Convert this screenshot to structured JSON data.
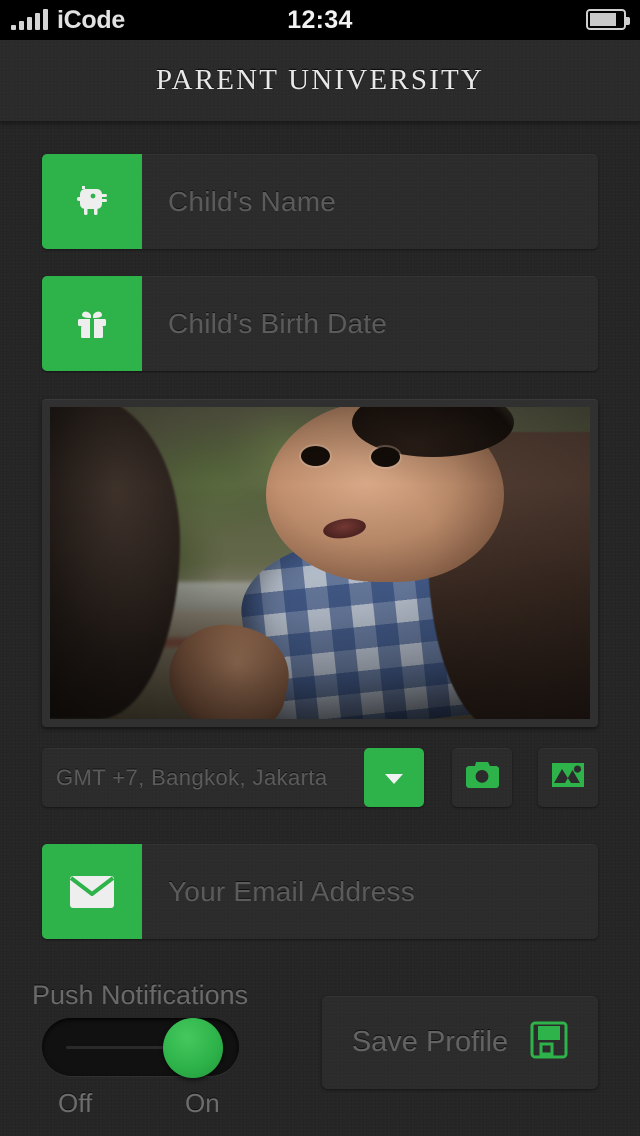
{
  "status_bar": {
    "carrier": "iCode",
    "time": "12:34",
    "signal_icon": "signal-bars-icon",
    "battery_icon": "battery-icon",
    "battery_level_percent": 72
  },
  "header": {
    "title": "PARENT UNIVERSITY"
  },
  "form": {
    "fields": [
      {
        "name": "child-name",
        "placeholder": "Child's Name",
        "value": "",
        "icon": "baby-animal-icon"
      },
      {
        "name": "child-birth-date",
        "placeholder": "Child's Birth Date",
        "value": "",
        "icon": "gift-icon"
      },
      {
        "name": "email-address",
        "placeholder": "Your Email Address",
        "value": "",
        "icon": "envelope-icon"
      }
    ],
    "photo": {
      "alt": "child photo preview",
      "icon": "photo-preview"
    },
    "timezone": {
      "value": "GMT +7, Bangkok, Jakarta",
      "dropdown_icon": "chevron-down-icon"
    },
    "camera_button": {
      "icon": "camera-icon"
    },
    "gallery_button": {
      "icon": "image-icon"
    },
    "push_notifications": {
      "label": "Push Notifications",
      "state": "On",
      "off_label": "Off",
      "on_label": "On"
    },
    "save": {
      "label": "Save Profile",
      "icon": "floppy-disk-save-icon"
    }
  },
  "colors": {
    "accent_green": "#2eb34a",
    "background": "#262626",
    "field_background": "#2c2c2c",
    "placeholder_text": "#5b5b5b",
    "header_background": "#2b2b2b"
  }
}
